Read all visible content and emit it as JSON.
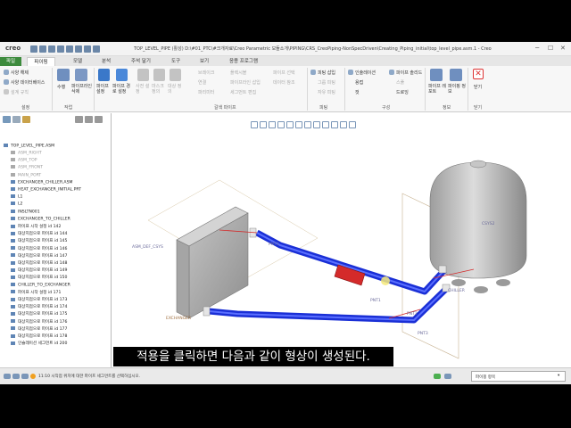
{
  "window": {
    "app_logo": "creo",
    "title": "TOP_LEVEL_PIPE (활성) D:\\#01_PTC\\#크개자료\\Creo Parametric 모듈소개\\PIPING\\CRS_CreoPiping-NonSpecDriven\\Creating_Piping_initial\\top_level_pipe.asm.1 - Creo"
  },
  "tabs": [
    "파일",
    "파이핑",
    "모델",
    "분석",
    "주석 달기",
    "도구",
    "보기",
    "응용 프로그램"
  ],
  "active_tab": 1,
  "ribbon": {
    "settings": {
      "items": [
        "사양 해제",
        "사양 데이터베이스",
        "설계 규칙"
      ],
      "group": "설정"
    },
    "work": {
      "items": [
        "수행",
        "파이프라인 삭제"
      ],
      "group": "작업"
    },
    "create": {
      "items": [
        "파이프 설정",
        "파이프 경로 설정",
        "사전 설정",
        "마스크 정의",
        "대상 정의"
      ]
    },
    "modify": {
      "items": [
        "브레이크",
        "연결",
        "파리미터",
        "파이프라인 삽입",
        "세그먼트 편집",
        "플렉시블",
        "파이프 선택",
        "데이터 참조"
      ],
      "group": "갈색 파이프"
    },
    "fitting": {
      "items": [
        "피팅 삽입",
        "그룹 피팅",
        "자유 피팅"
      ],
      "group": "피팅"
    },
    "construct": {
      "items": [
        "인슐레이션",
        "파이프 솔리드",
        "용접",
        "스풀",
        "컷",
        "드로잉"
      ],
      "group": "구성"
    },
    "info": {
      "items": [
        "파이프 레포트",
        "파이핑 정보"
      ],
      "group": "정보"
    },
    "close": {
      "label": "닫기",
      "group": "닫기"
    }
  },
  "tree": {
    "root": "TOP_LEVEL_PIPE.ASM",
    "items": [
      {
        "label": "ASM_RIGHT",
        "dim": true
      },
      {
        "label": "ASM_TOP",
        "dim": true
      },
      {
        "label": "ASM_FRONT",
        "dim": true
      },
      {
        "label": "MAIN_PORT",
        "dim": true
      },
      {
        "label": "EXCHANGER_CHILLER.ASM",
        "dim": false
      },
      {
        "label": "HEAT_EXCHANGER_INITIAL.PRT",
        "dim": false
      },
      {
        "label": "L1",
        "dim": false
      },
      {
        "label": "L2",
        "dim": false
      },
      {
        "label": "INSLTN001",
        "dim": false
      },
      {
        "label": "EXCHANGER_TO_CHILLER",
        "dim": false
      },
      {
        "label": "파이프 시작 설정 id 142",
        "dim": false
      },
      {
        "label": "대상지점으로 파이프 id 144",
        "dim": false
      },
      {
        "label": "대상지점으로 파이프 id 145",
        "dim": false
      },
      {
        "label": "대상지점으로 파이프 id 146",
        "dim": false
      },
      {
        "label": "대상지점으로 파이프 id 147",
        "dim": false
      },
      {
        "label": "대상지점으로 파이프 id 148",
        "dim": false
      },
      {
        "label": "대상지점으로 파이프 id 149",
        "dim": false
      },
      {
        "label": "대상지점으로 파이프 id 150",
        "dim": false
      },
      {
        "label": "CHILLER_TO_EXCHANGER",
        "dim": false
      },
      {
        "label": "파이프 시작 설정 id 171",
        "dim": false
      },
      {
        "label": "대상지점으로 파이프 id 173",
        "dim": false
      },
      {
        "label": "대상지점으로 파이프 id 174",
        "dim": false
      },
      {
        "label": "대상지점으로 파이프 id 175",
        "dim": false
      },
      {
        "label": "대상지점으로 파이프 id 176",
        "dim": false
      },
      {
        "label": "대상지점으로 파이프 id 177",
        "dim": false
      },
      {
        "label": "대상지점으로 파이프 id 178",
        "dim": false
      },
      {
        "label": "인슐레이션 세그먼트 id 200",
        "dim": false
      }
    ]
  },
  "viewport": {
    "labels": {
      "asm_csys": "ASM_DEF_CSYS",
      "pnt4": "PNT4",
      "pnt1": "PNT1",
      "pnt2": "PNT2",
      "pnt3": "PNT3",
      "exchanger": "EXCHANGER",
      "chiller": "CHILLER",
      "csys2": "CSYS2"
    }
  },
  "status": {
    "message": "11:10 시작점 위치에 대한 파이프 세그먼트를 선택하십시오.",
    "filter": "파이핑 항목"
  },
  "subtitle": "적용을 클릭하면 다음과 같이 형상이 생성된다.",
  "colors": {
    "pipe": "#1a2fd6",
    "pipe_highlight": "#5a6fff",
    "insulation": "#d42a2a",
    "tank": "#a9a9a9",
    "file_tab": "#3d8b3d",
    "datum": "#c7b291"
  }
}
